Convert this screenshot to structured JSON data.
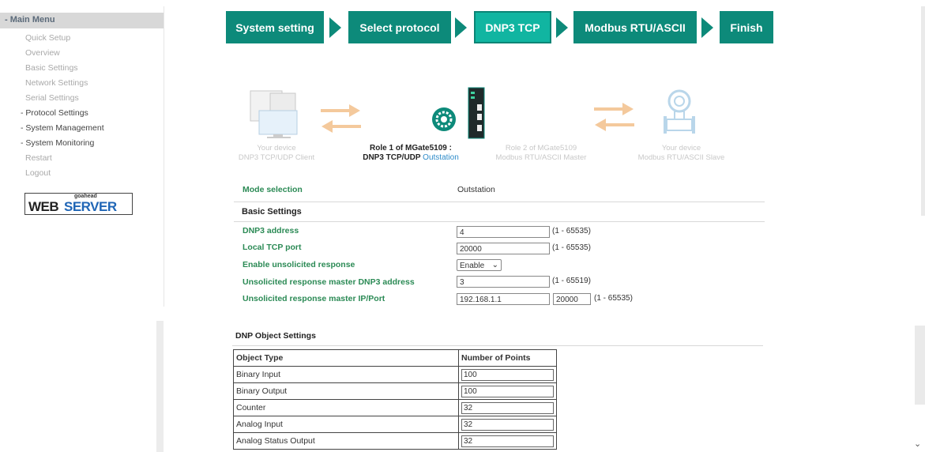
{
  "menu": {
    "title": "- Main Menu",
    "items": [
      {
        "label": "Quick Setup",
        "style": "dim"
      },
      {
        "label": "Overview",
        "style": "dim"
      },
      {
        "label": "Basic Settings",
        "style": "dim"
      },
      {
        "label": "Network Settings",
        "style": "dim"
      },
      {
        "label": "Serial Settings",
        "style": "dim"
      },
      {
        "label": "- Protocol Settings",
        "style": "dark"
      },
      {
        "label": "- System Management",
        "style": "dark"
      },
      {
        "label": "- System Monitoring",
        "style": "dark"
      },
      {
        "label": "Restart",
        "style": "dim"
      },
      {
        "label": "Logout",
        "style": "dim"
      }
    ],
    "logo": {
      "small": "goahead",
      "big1": "WEB",
      "big2": "SERVER"
    }
  },
  "wizard": {
    "steps": [
      "System setting",
      "Select protocol",
      "DNP3 TCP",
      "Modbus RTU/ASCII",
      "Finish"
    ],
    "active": 2
  },
  "diagram": {
    "left_device": {
      "line1": "Your device",
      "line2": "DNP3 TCP/UDP Client"
    },
    "role1": {
      "line1": "Role 1 of MGate5109 :",
      "line2a": "DNP3 TCP/UDP ",
      "line2b": "Outstation"
    },
    "role2": {
      "line1": "Role 2 of MGate5109",
      "line2": "Modbus RTU/ASCII Master"
    },
    "right_device": {
      "line1": "Your device",
      "line2": "Modbus RTU/ASCII Slave"
    }
  },
  "form": {
    "mode_label": "Mode selection",
    "mode_value": "Outstation",
    "basic_title": "Basic Settings",
    "dnp3_address": {
      "label": "DNP3 address",
      "value": "4",
      "range": "(1 - 65535)"
    },
    "local_tcp_port": {
      "label": "Local TCP port",
      "value": "20000",
      "range": "(1 - 65535)"
    },
    "unsolicited": {
      "label": "Enable unsolicited response",
      "value": "Enable"
    },
    "unsol_dnp3": {
      "label": "Unsolicited response master DNP3 address",
      "value": "3",
      "range": "(1 - 65519)"
    },
    "unsol_ip": {
      "label": "Unsolicited response master IP/Port",
      "ip": "192.168.1.1",
      "port": "20000",
      "range": "(1 - 65535)"
    }
  },
  "dnp_objects": {
    "title": "DNP Object Settings",
    "headers": [
      "Object Type",
      "Number of Points"
    ],
    "rows": [
      {
        "type": "Binary Input",
        "points": "100"
      },
      {
        "type": "Binary Output",
        "points": "100"
      },
      {
        "type": "Counter",
        "points": "32"
      },
      {
        "type": "Analog Input",
        "points": "32"
      },
      {
        "type": "Analog Status Output",
        "points": "32"
      }
    ]
  },
  "colors": {
    "step": "#0d8a7a",
    "step_active": "#11b5a1",
    "label_green": "#2b8a55",
    "role_blue": "#2e8bc9"
  }
}
